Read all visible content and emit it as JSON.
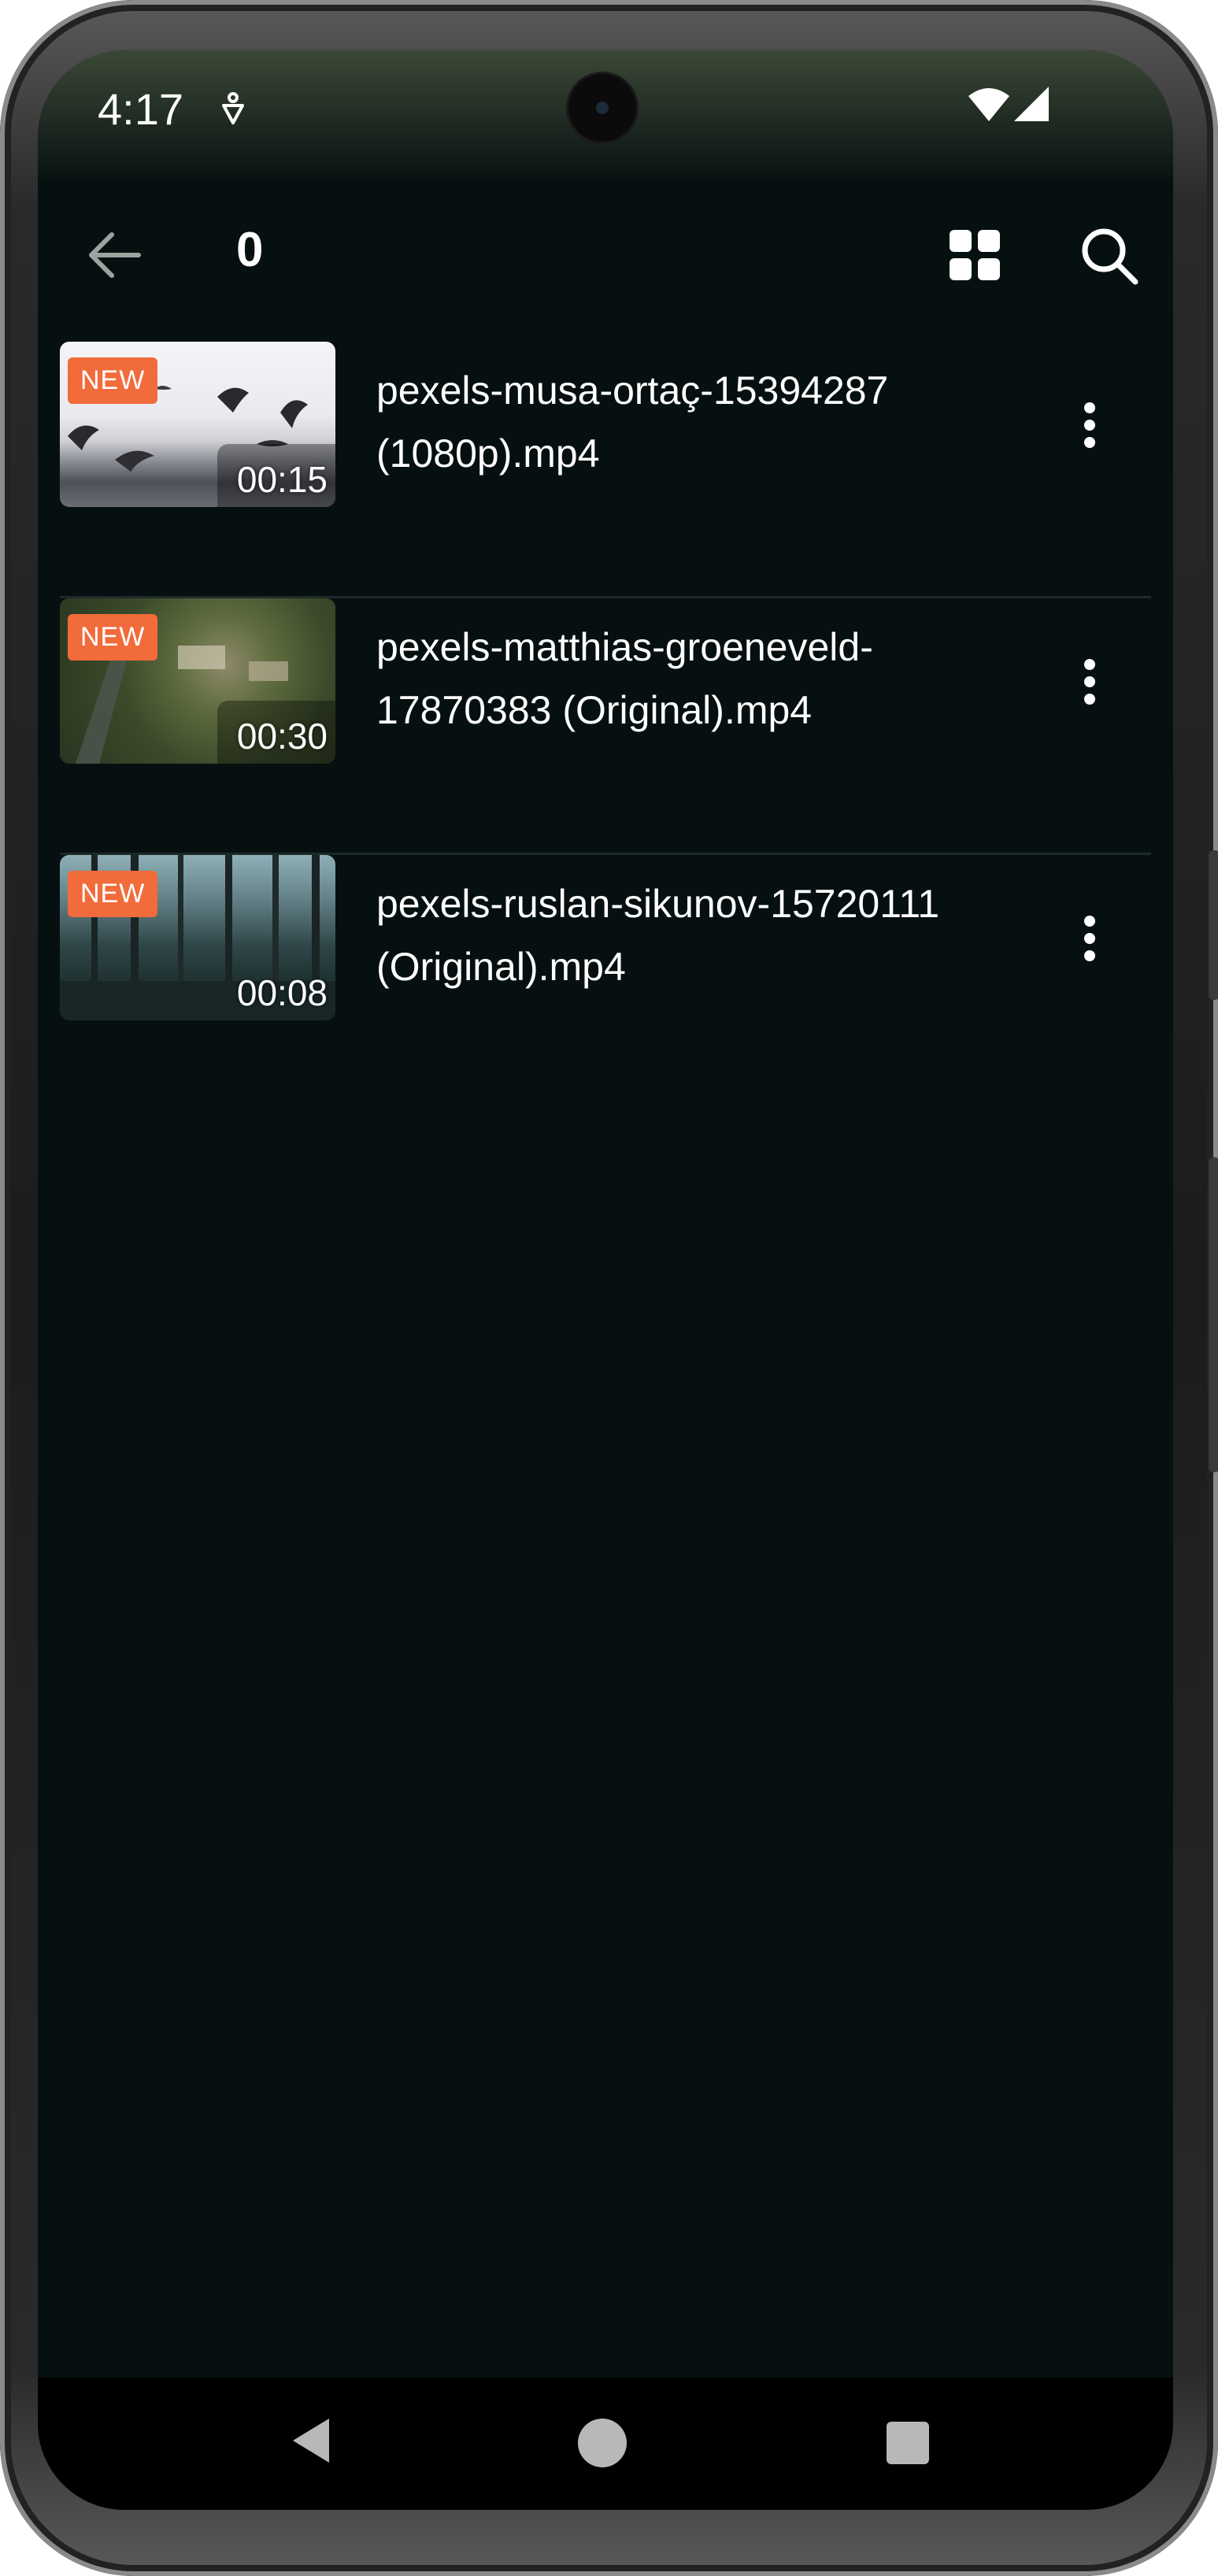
{
  "status_bar": {
    "time": "4:17"
  },
  "app_bar": {
    "title": "0",
    "back_icon": "arrow-left-icon",
    "grid_icon": "grid-view-icon",
    "search_icon": "search-icon"
  },
  "videos": [
    {
      "badge": "NEW",
      "duration": "00:15",
      "name": "pexels-musa-ortaç-15394287 (1080p).mp4"
    },
    {
      "badge": "NEW",
      "duration": "00:30",
      "name": "pexels-matthias-groeneveld-17870383 (Original).mp4"
    },
    {
      "badge": "NEW",
      "duration": "00:08",
      "name": "pexels-ruslan-sikunov-15720111 (Original).mp4"
    }
  ],
  "colors": {
    "background": "#061010",
    "accent_badge": "#f26b3a",
    "text": "#ffffff"
  },
  "nav_bar": {
    "back_icon": "triangle-back-icon",
    "home_icon": "circle-home-icon",
    "recents_icon": "square-recents-icon"
  }
}
